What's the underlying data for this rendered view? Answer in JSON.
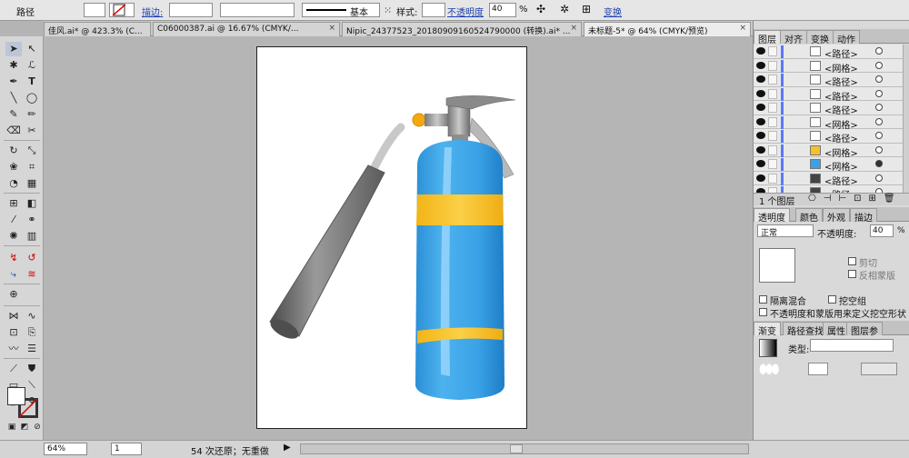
{
  "control_bar": {
    "object_type": "路径",
    "stroke_label": "描边:",
    "stroke_style": "基本",
    "style_label": "样式:",
    "opacity_label": "不透明度",
    "opacity_value": "40",
    "opacity_unit": "%",
    "transform_label": "变换"
  },
  "doc_tabs": [
    {
      "label": "佳风.ai* @ 423.3% (C...",
      "active": false
    },
    {
      "label": "C06000387.ai @ 16.67% (CMYK/...",
      "active": false
    },
    {
      "label": "Nipic_24377523_20180909160524790000 (转换).ai* ...",
      "active": false
    },
    {
      "label": "未标题-5* @ 64% (CMYK/预览)",
      "active": true
    }
  ],
  "layers_panel": {
    "tabs": [
      "图层",
      "对齐",
      "变换",
      "动作"
    ],
    "rows": [
      {
        "name": "<路径>",
        "thumb": "gray"
      },
      {
        "name": "<网格>",
        "thumb": "gray"
      },
      {
        "name": "<路径>",
        "thumb": "line"
      },
      {
        "name": "<路径>",
        "thumb": "gray"
      },
      {
        "name": "<路径>",
        "thumb": "gray"
      },
      {
        "name": "<网格>",
        "thumb": "gray"
      },
      {
        "name": "<路径>",
        "thumb": "gray"
      },
      {
        "name": "<网格>",
        "thumb": "yellow"
      },
      {
        "name": "<网格>",
        "thumb": "blue"
      },
      {
        "name": "<路径>",
        "thumb": "dark"
      },
      {
        "name": "<路径>",
        "thumb": "dark"
      }
    ],
    "footer": "1 个图层"
  },
  "transparency_panel": {
    "tabs": [
      "透明度",
      "颜色",
      "外观",
      "描边"
    ],
    "blend_mode": "正常",
    "opacity_label": "不透明度:",
    "opacity_value": "40",
    "opacity_unit": "%",
    "clip_label": "剪切",
    "invert_label": "反相蒙版",
    "isolate_label": "隔离混合",
    "knockout_label": "挖空组",
    "define_label": "不透明度和蒙版用来定义挖空形状"
  },
  "gradient_panel": {
    "tabs": [
      "渐变",
      "路径查找",
      "属性",
      "图层参"
    ],
    "type_label": "类型:"
  },
  "status_bar": {
    "zoom": "64%",
    "artboard": "1",
    "undo_text": "54 次还原；无重做"
  },
  "colors": {
    "cyl_blue": "#3aa2e6",
    "band_yellow": "#f8c228",
    "hose_gray": "#6f6f6f",
    "valve_gray": "#8a8a8a",
    "accent": "#4d6cff"
  }
}
